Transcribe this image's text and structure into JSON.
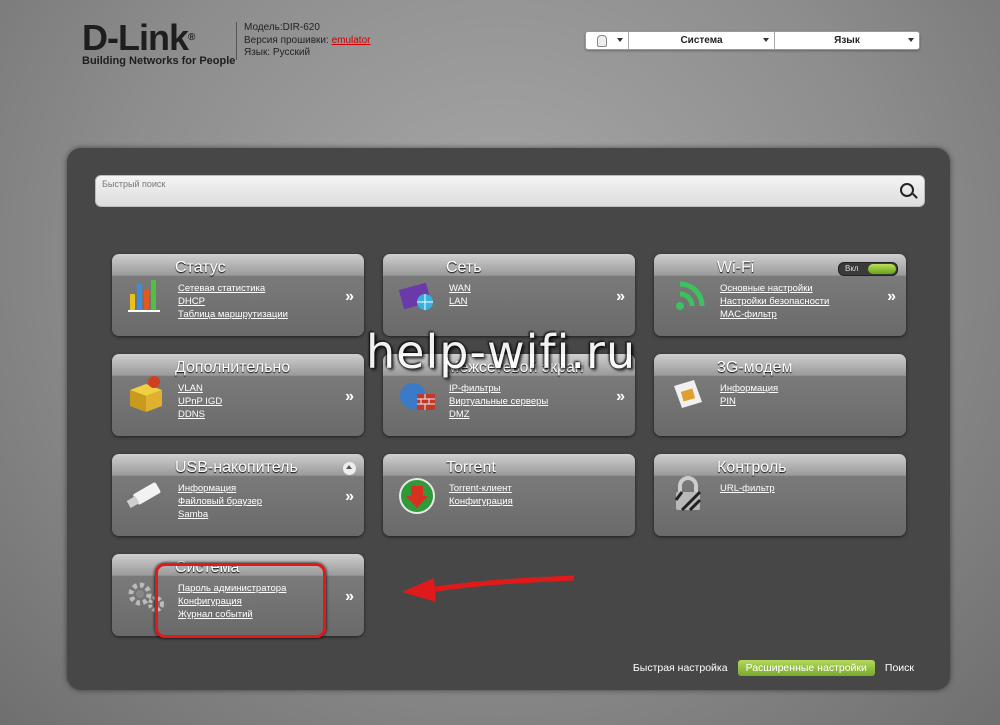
{
  "header": {
    "logo_text": "D-Link",
    "logo_reg": "®",
    "logo_tagline": "Building Networks for People",
    "model": "Модель:DIR-620",
    "firmware_label": "Версия прошивки: ",
    "firmware_value": "emulator",
    "language_info": "Язык: Русский"
  },
  "topbar": {
    "system_label": "Система",
    "language_label": "Язык"
  },
  "search": {
    "placeholder": "Быстрый поиск"
  },
  "tiles": {
    "status": {
      "title": "Статус",
      "links": [
        "Сетевая статистика",
        "DHCP",
        "Таблица маршрутизации"
      ],
      "arrow": "»"
    },
    "network": {
      "title": "Сеть",
      "links": [
        "WAN",
        "LAN"
      ],
      "arrow": "»"
    },
    "wifi": {
      "title": "Wi-Fi",
      "toggle_label": "Вкл",
      "links": [
        "Основные настройки",
        "Настройки безопасности",
        "MAC-фильтр"
      ],
      "arrow": "»"
    },
    "advanced": {
      "title": "Дополнительно",
      "links": [
        "VLAN",
        "UPnP IGD",
        "DDNS"
      ],
      "arrow": "»"
    },
    "firewall": {
      "title": "Межсетевой экран",
      "links": [
        "IP-фильтры",
        "Виртуальные серверы",
        "DMZ"
      ],
      "arrow": "»"
    },
    "modem": {
      "title": "3G-модем",
      "links": [
        "Информация",
        "PIN"
      ],
      "arrow": ""
    },
    "usb": {
      "title": "USB-накопитель",
      "links": [
        "Информация",
        "Файловый браузер",
        "Samba"
      ],
      "arrow": "»"
    },
    "torrent": {
      "title": "Torrent",
      "links": [
        "Torrent-клиент",
        "Конфигурация"
      ],
      "arrow": ""
    },
    "control": {
      "title": "Контроль",
      "links": [
        "URL-фильтр"
      ],
      "arrow": ""
    },
    "system": {
      "title": "Система",
      "links": [
        "Пароль администратора",
        "Конфигурация",
        "Журнал событий"
      ],
      "arrow": "»"
    }
  },
  "bottom_nav": {
    "quick_setup": "Быстрая настройка",
    "advanced_settings": "Расширенные настройки",
    "search": "Поиск"
  },
  "watermark": "help-wifi.ru",
  "colors": {
    "accent_green": "#8cbf3a",
    "highlight_red": "#e01a1a",
    "panel": "#474747"
  }
}
